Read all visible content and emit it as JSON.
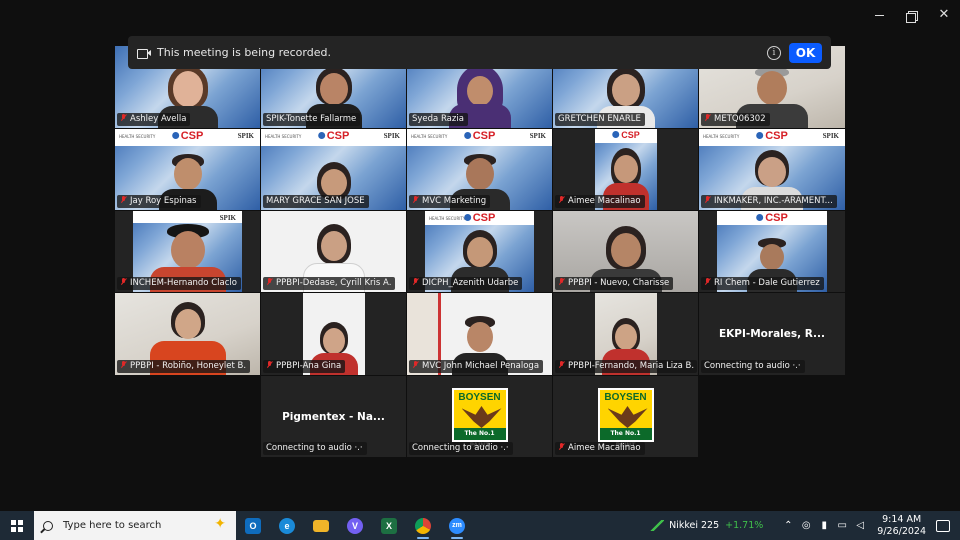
{
  "window": {
    "min_label": "",
    "max_label": "",
    "close_label": "✕"
  },
  "banner": {
    "text": "This meeting is being recorded.",
    "info_label": "i",
    "ok_label": "OK"
  },
  "branding": {
    "csp": "CSP",
    "spk": "SPIK",
    "health": "HEALTH SECURITY",
    "boysen_word": "BOYSEN",
    "boysen_tag": "The No.1 PAINT"
  },
  "participants": [
    {
      "name": "Ashley Avella",
      "muted": true
    },
    {
      "name": "SPIK-Tonette Fallarme",
      "muted": false,
      "speaking": true
    },
    {
      "name": "Syeda Razia",
      "muted": false
    },
    {
      "name": "GRETCHEN ENARLE",
      "muted": false
    },
    {
      "name": "METQ06302",
      "muted": true
    },
    {
      "name": "Jay Roy Espinas",
      "muted": true
    },
    {
      "name": "MARY GRACE SAN JOSE",
      "muted": false
    },
    {
      "name": "MVC Marketing",
      "muted": true
    },
    {
      "name": "Aimee Macalinao",
      "muted": true
    },
    {
      "name": "INKMAKER, INC.-ARAMENT...",
      "muted": true
    },
    {
      "name": "INCHEM-Hernando Claclo",
      "muted": true
    },
    {
      "name": "PPBPI-Dedase, Cyrill Kris A.",
      "muted": true
    },
    {
      "name": "DICPH_Azenith Udarbe",
      "muted": true
    },
    {
      "name": "PPBPI - Nuevo, Charisse",
      "muted": true
    },
    {
      "name": "RI Chem - Dale Gutierrez",
      "muted": true
    },
    {
      "name": "PPBPI - Robiño, Honeylet B.",
      "muted": true
    },
    {
      "name": "PPBPI-Ana Gina",
      "muted": true
    },
    {
      "name": "MVC John Michael Penaloga",
      "muted": true
    },
    {
      "name": "PPBPI-Fernando, Maria Liza B.",
      "muted": true
    },
    {
      "name": "EKPI-Morales, R...",
      "status": "Connecting to audio ·.·"
    },
    {
      "name": "Pigmentex - Na...",
      "status": "Connecting to audio ·.·"
    },
    {
      "name": "",
      "status": "Connecting to audio ·.·"
    },
    {
      "name": "Aimee Macalinao",
      "muted": true
    }
  ],
  "taskbar": {
    "search_placeholder": "Type here to search",
    "apps": [
      {
        "icon": "outlook-icon",
        "label": "O",
        "color": "#0f6cbd"
      },
      {
        "icon": "edge-icon",
        "label": "e",
        "color": "#1a8ad8"
      },
      {
        "icon": "file-explorer-icon",
        "label": "",
        "color": "#f0b429"
      },
      {
        "icon": "viber-icon",
        "label": "V",
        "color": "#7360f2"
      },
      {
        "icon": "excel-icon",
        "label": "X",
        "color": "#1d6f42"
      },
      {
        "icon": "chrome-icon",
        "label": "",
        "color": "#db4437"
      },
      {
        "icon": "zoom-icon",
        "label": "zm",
        "color": "#2d8cff"
      }
    ],
    "nikkei_label": "Nikkei 225",
    "nikkei_change": "+1.71%",
    "time": "9:14 AM",
    "date": "9/26/2024"
  }
}
